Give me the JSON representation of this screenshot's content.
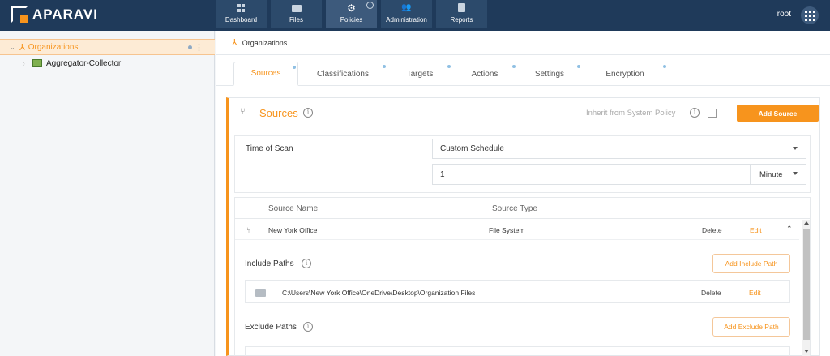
{
  "app": {
    "brand": "APARAVI",
    "accent_color": "#f7941d",
    "topbar_color": "#1f3a5a"
  },
  "nav": {
    "items": [
      {
        "label": "Dashboard",
        "icon": "dashboard-icon"
      },
      {
        "label": "Files",
        "icon": "folder-icon"
      },
      {
        "label": "Policies",
        "icon": "gear-icon",
        "active": true
      },
      {
        "label": "Administration",
        "icon": "users-icon"
      },
      {
        "label": "Reports",
        "icon": "clipboard-icon"
      }
    ],
    "user": "root"
  },
  "tree": {
    "root_label": "Organizations",
    "child_label": "Aggregator-Collector"
  },
  "breadcrumb": {
    "label": "Organizations"
  },
  "tabs": [
    "Sources",
    "Classifications",
    "Targets",
    "Actions",
    "Settings",
    "Encryption"
  ],
  "active_tab": "Sources",
  "panel": {
    "title": "Sources",
    "inherit_label": "Inherit from System Policy",
    "inherit_checked": false,
    "add_source_label": "Add Source"
  },
  "scan": {
    "label": "Time of Scan",
    "schedule_value": "Custom Schedule",
    "interval_value": "1",
    "unit_value": "Minute"
  },
  "sources_table": {
    "columns": [
      "Source Name",
      "Source Type"
    ],
    "rows": [
      {
        "name": "New York Office",
        "type": "File System",
        "delete": "Delete",
        "edit": "Edit"
      }
    ]
  },
  "include": {
    "label": "Include Paths",
    "add_label": "Add Include Path",
    "paths": [
      {
        "path": "C:\\Users\\New York Office\\OneDrive\\Desktop\\Organization Files",
        "delete": "Delete",
        "edit": "Edit"
      }
    ]
  },
  "exclude": {
    "label": "Exclude Paths",
    "add_label": "Add Exclude Path"
  }
}
